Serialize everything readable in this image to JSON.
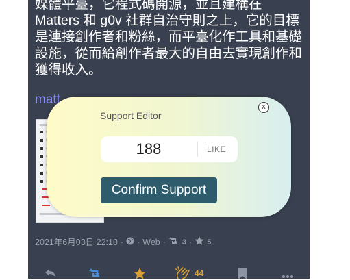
{
  "post": {
    "lines": [
      "媒體平臺，它程式碼開源，並且建構在",
      "Matters 和 g0v 社群自治守則之上，它的目標",
      "是連接創作者和粉絲，而平臺化作工具和基礎",
      "設施，從而給創作者最大的自由去實現創作和",
      "獲得收入。"
    ],
    "link_visible": "matt"
  },
  "meta": {
    "timestamp": "2021年6月03日 22:10",
    "source": "Web",
    "reblogs": "3",
    "favourites": "5"
  },
  "actions": {
    "support_count": "44",
    "reply_icon": "reply-icon",
    "reblog_icon": "reblog-icon",
    "favourite_icon": "star-icon",
    "support_icon": "clap-icon",
    "bookmark_icon": "bookmark-icon",
    "more_icon": "more-icon"
  },
  "support_popup": {
    "title": "Support Editor",
    "close_label": "x",
    "amount": "188",
    "unit": "LIKE",
    "confirm_label": "Confirm Support"
  },
  "colors": {
    "card_bg": "#39404f",
    "link": "#8c8dff",
    "accent": "#d8a035",
    "reblog_active": "#4a90d9",
    "confirm_bg": "#2e5c6c"
  }
}
